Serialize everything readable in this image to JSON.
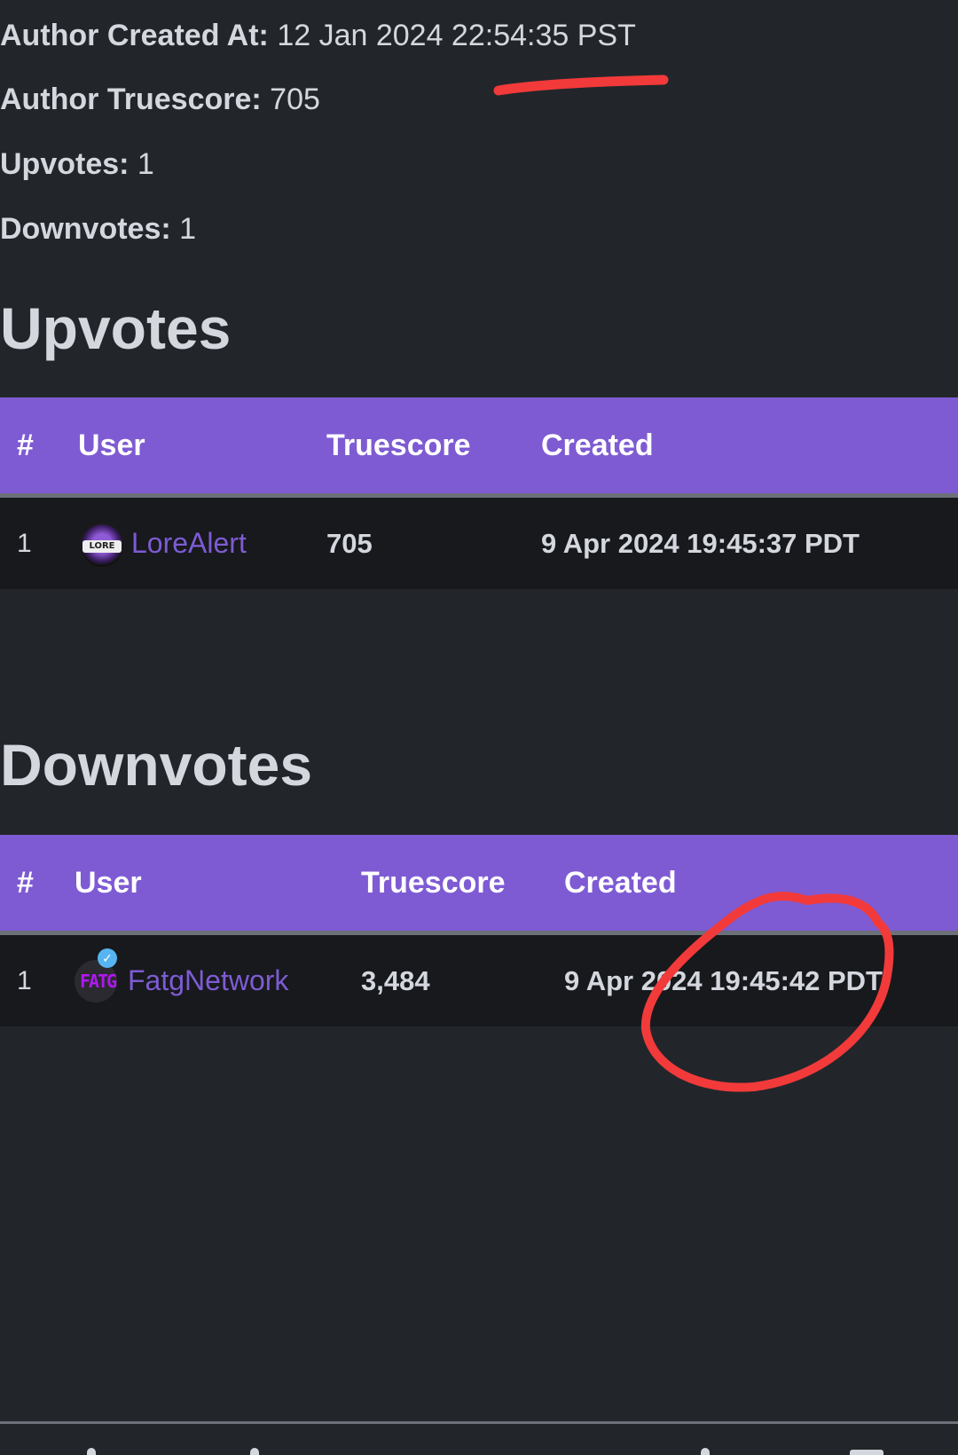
{
  "author_info": {
    "created_at": {
      "label": "Author Created At:",
      "value": "12 Jan 2024 22:54:35 PST"
    },
    "truescore": {
      "label": "Author Truescore:",
      "value": "705"
    },
    "upvotes": {
      "label": "Upvotes:",
      "value": "1"
    },
    "downvotes": {
      "label": "Downvotes:",
      "value": "1"
    }
  },
  "upvotes_section": {
    "title": "Upvotes",
    "columns": [
      "#",
      "User",
      "Truescore",
      "Created"
    ],
    "rows": [
      {
        "rank": "1",
        "user": "LoreAlert",
        "avatar_icon": "lore-logo-avatar",
        "verified": false,
        "truescore": "705",
        "created": "9 Apr 2024 19:45:37 PDT"
      }
    ]
  },
  "downvotes_section": {
    "title": "Downvotes",
    "columns": [
      "#",
      "User",
      "Truescore",
      "Created"
    ],
    "rows": [
      {
        "rank": "1",
        "user": "FatgNetwork",
        "avatar_icon": "fatg-logo-avatar",
        "verified": true,
        "truescore": "3,484",
        "created": "9 Apr 2024 19:45:42 PDT"
      }
    ]
  },
  "annotations": {
    "underline": {
      "target": "author_info.created_at.value",
      "color": "#f23a3a"
    },
    "circle": {
      "target": "downvotes_section.rows.0.created",
      "color": "#f23a3a"
    }
  },
  "colors": {
    "background": "#22262b",
    "table_header": "#7e5bd3",
    "row_background": "#17191d",
    "link": "#7e5bd3",
    "text": "#d4d8de",
    "annotation": "#f23a3a",
    "verified_badge": "#56b4f0"
  },
  "bottom_nav": {
    "icons": [
      "nav-icon-1",
      "nav-icon-2",
      "nav-icon-3",
      "nav-icon-4"
    ]
  }
}
